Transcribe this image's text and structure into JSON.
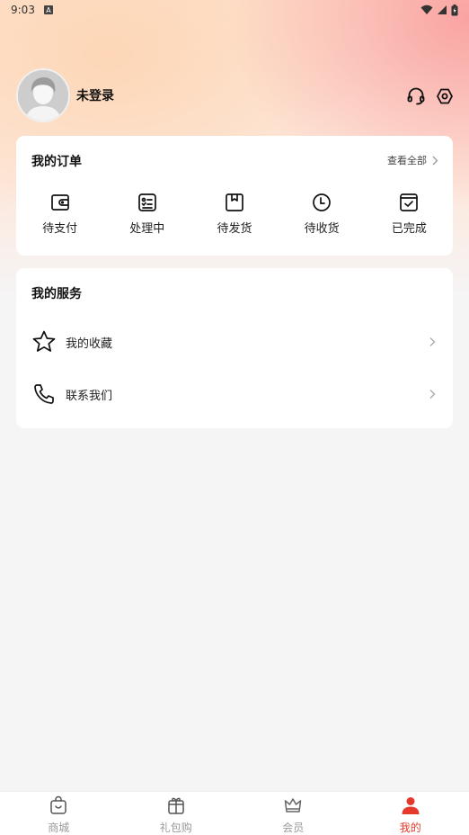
{
  "status_bar": {
    "time": "9:03",
    "badge": "A"
  },
  "profile": {
    "login_text": "未登录"
  },
  "orders": {
    "title": "我的订单",
    "view_all": "查看全部",
    "items": [
      {
        "label": "待支付",
        "icon": "wallet-icon"
      },
      {
        "label": "处理中",
        "icon": "form-icon"
      },
      {
        "label": "待发货",
        "icon": "package-icon"
      },
      {
        "label": "待收货",
        "icon": "clock-icon"
      },
      {
        "label": "已完成",
        "icon": "checkbox-icon"
      }
    ]
  },
  "services": {
    "title": "我的服务",
    "items": [
      {
        "label": "我的收藏",
        "icon": "star-icon"
      },
      {
        "label": "联系我们",
        "icon": "phone-icon"
      }
    ]
  },
  "tabbar": {
    "items": [
      {
        "label": "商城",
        "icon": "shopping-bag-icon"
      },
      {
        "label": "礼包购",
        "icon": "gift-icon"
      },
      {
        "label": "会员",
        "icon": "crown-icon"
      },
      {
        "label": "我的",
        "icon": "person-icon",
        "active": true
      }
    ]
  },
  "colors": {
    "accent": "#e53a2b",
    "background": "#f5f5f5",
    "card": "#ffffff"
  }
}
